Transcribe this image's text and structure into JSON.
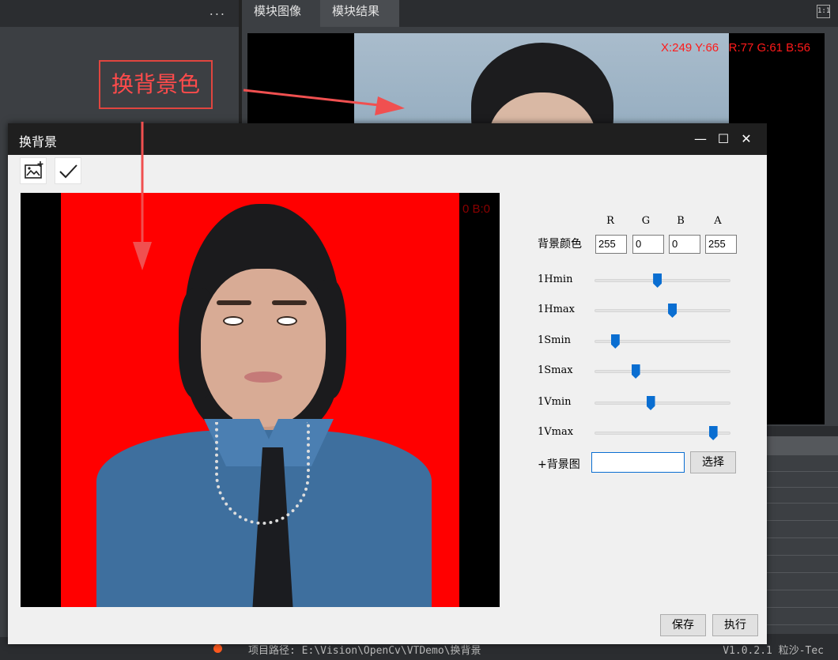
{
  "app": {
    "left_panel": {
      "menu_label": "..."
    },
    "tabs": [
      {
        "label": "模块图像"
      },
      {
        "label": "模块结果"
      }
    ],
    "zoom_label": "1:1",
    "viewer_pixel_info": "X:249 Y:66   R:77 G:61 B:56",
    "status": {
      "path": "项目路径: E:\\Vision\\OpenCv\\VTDemo\\换背景",
      "version": "V1.0.2.1 粒沙-Tec"
    }
  },
  "annotation": {
    "label": "换背景色",
    "color": "#e0453f"
  },
  "dialog": {
    "title": "换背景",
    "window_buttons": {
      "minimize": "—",
      "maximize": "☐",
      "close": "✕"
    },
    "toolbar": {
      "add_image_icon": "image-add-icon",
      "confirm_icon": "check-icon"
    },
    "preview_pixel_info": "0 B:0",
    "background_color": {
      "label": "背景颜色",
      "columns": [
        "R",
        "G",
        "B",
        "A"
      ],
      "values": [
        "255",
        "0",
        "0",
        "255"
      ]
    },
    "sliders": [
      {
        "label": "1Hmin",
        "level": 0.46
      },
      {
        "label": "1Hmax",
        "level": 0.57
      },
      {
        "label": "1Smin",
        "level": 0.15
      },
      {
        "label": "1Smax",
        "level": 0.3
      },
      {
        "label": "1Vmin",
        "level": 0.41
      },
      {
        "label": "1Vmax",
        "level": 0.87
      }
    ],
    "background_image": {
      "label": "+背景图",
      "value": "",
      "select_label": "选择"
    },
    "save_label": "保存",
    "run_label": "执行"
  },
  "colors": {
    "preview_bg": "#ff0000",
    "slider_thumb": "#0a6ed1",
    "pixel_info": "#ff1a1a"
  }
}
